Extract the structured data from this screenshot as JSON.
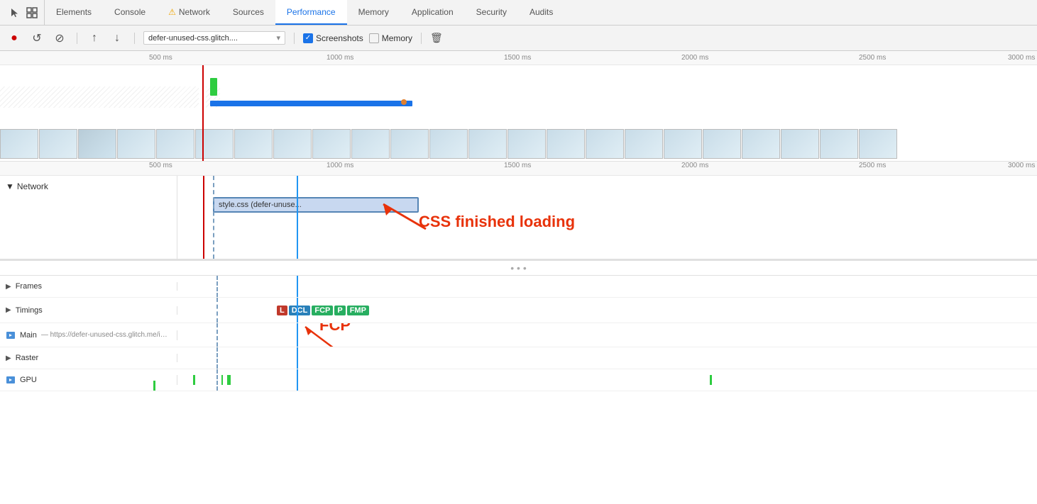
{
  "tabs": [
    {
      "id": "elements",
      "label": "Elements",
      "active": false,
      "icon": ""
    },
    {
      "id": "console",
      "label": "Console",
      "active": false,
      "icon": ""
    },
    {
      "id": "network",
      "label": "Network",
      "active": false,
      "icon": "⚠",
      "iconColor": "#f0a500"
    },
    {
      "id": "sources",
      "label": "Sources",
      "active": false,
      "icon": ""
    },
    {
      "id": "performance",
      "label": "Performance",
      "active": true,
      "icon": ""
    },
    {
      "id": "memory",
      "label": "Memory",
      "active": false,
      "icon": ""
    },
    {
      "id": "application",
      "label": "Application",
      "active": false,
      "icon": ""
    },
    {
      "id": "security",
      "label": "Security",
      "active": false,
      "icon": ""
    },
    {
      "id": "audits",
      "label": "Audits",
      "active": false,
      "icon": ""
    }
  ],
  "toolbar": {
    "record_label": "●",
    "reload_label": "↺",
    "stop_label": "⊘",
    "upload_label": "↑",
    "download_label": "↓",
    "url_text": "defer-unused-css.glitch....",
    "screenshots_label": "Screenshots",
    "memory_label": "Memory"
  },
  "timeline": {
    "ruler_ticks": [
      "500 ms",
      "1000 ms",
      "1500 ms",
      "2000 ms",
      "2500 ms",
      "3000 ms"
    ],
    "ruler_ticks_lower": [
      "500 ms",
      "1000 ms",
      "1500 ms",
      "2000 ms",
      "2500 ms",
      "3000 ms"
    ]
  },
  "network_section": {
    "label": "Network",
    "css_file_label": "style.css (defer-unuse...",
    "annotation": "CSS finished loading"
  },
  "tracks": [
    {
      "id": "frames",
      "label": "Frames",
      "expanded": false
    },
    {
      "id": "timings",
      "label": "Timings",
      "expanded": false
    },
    {
      "id": "main",
      "label": "Main",
      "expanded": false,
      "detail": "— https://defer-unused-css.glitch.me/index-optimized.html"
    },
    {
      "id": "raster",
      "label": "Raster",
      "expanded": false
    },
    {
      "id": "gpu",
      "label": "GPU",
      "expanded": false
    }
  ],
  "timing_badges": [
    {
      "label": "L",
      "class": "badge-l"
    },
    {
      "label": "DCL",
      "class": "badge-dcl"
    },
    {
      "label": "FCP",
      "class": "badge-fcp"
    },
    {
      "label": "P",
      "class": "badge-fcp"
    },
    {
      "label": "FMP",
      "class": "badge-fmp"
    }
  ],
  "fcp_annotation": "FCP",
  "colors": {
    "active_tab": "#1a73e8",
    "red_line": "#c00",
    "blue_line": "#2196F3",
    "css_bar": "#a8c4e0"
  }
}
